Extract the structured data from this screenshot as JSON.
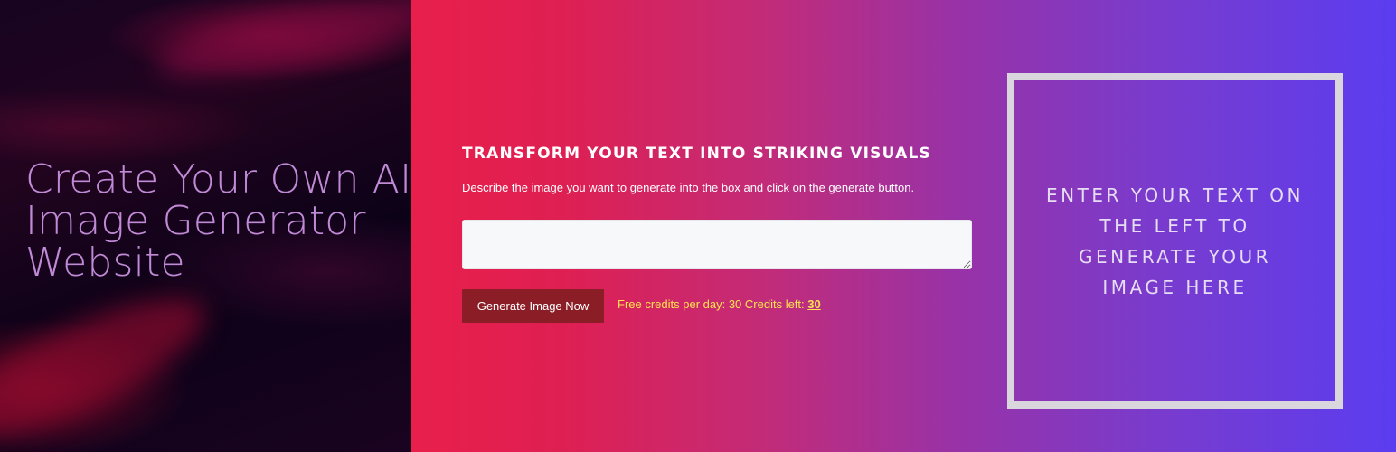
{
  "hero": {
    "title": "Create Your Own AI Image Generator Website"
  },
  "form": {
    "heading": "TRANSFORM YOUR TEXT INTO STRIKING VISUALS",
    "description": "Describe the image you want to generate into the box and click on the generate button.",
    "prompt_value": "",
    "generate_label": "Generate Image Now",
    "credits_prefix": "Free credits per day: 30 Credits left:",
    "credits_left": "30"
  },
  "preview": {
    "placeholder": "ENTER YOUR TEXT ON THE LEFT TO GENERATE YOUR IMAGE HERE"
  },
  "colors": {
    "gradient_start": "#e81f4b",
    "gradient_end": "#5b3df0",
    "button_bg": "#8b1d26",
    "credits_text": "#ffe44d",
    "hero_text": "#c08ad6"
  }
}
